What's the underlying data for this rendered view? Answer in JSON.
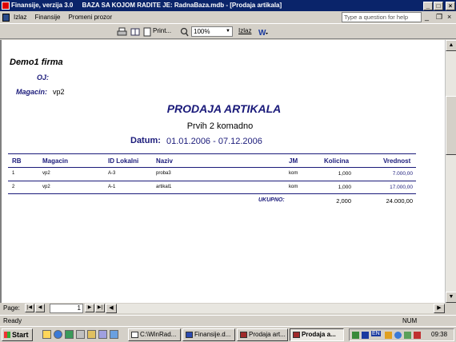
{
  "window": {
    "title": "Finansije, verzija 3.0     BAZA SA KOJOM RADITE JE: RadnaBaza.mdb - [Prodaja artikala]",
    "controls": {
      "minimize": "_",
      "maximize": "□",
      "close": "×"
    }
  },
  "menu": {
    "items": [
      "Izlaz",
      "Finansije",
      "Promeni prozor"
    ],
    "help_placeholder": "Type a question for help",
    "mdi_controls": {
      "minimize": "_",
      "restore": "❐",
      "close": "×"
    }
  },
  "toolbar": {
    "print_label": "Print...",
    "zoom_value": "100%",
    "exit_label": "Izlaz"
  },
  "report": {
    "company": "Demo1 firma",
    "oj_label": "OJ:",
    "oj_value": "",
    "magacin_label": "Magacin:",
    "magacin_value": "vp2",
    "title": "PRODAJA ARTIKALA",
    "subtitle": "Prvih 2 komadno",
    "datum_label": "Datum:",
    "datum_value": "01.01.2006 - 07.12.2006",
    "columns": [
      "RB",
      "Magacin",
      "ID Lokalni",
      "Naziv",
      "JM",
      "Kolicina",
      "Vrednost"
    ],
    "rows": [
      {
        "rb": "1",
        "magacin": "vp2",
        "id": "A-3",
        "naziv": "proba3",
        "jm": "kom",
        "kolicina": "1,000",
        "vrednost": "7.000,00"
      },
      {
        "rb": "2",
        "magacin": "vp2",
        "id": "A-1",
        "naziv": "artikal1",
        "jm": "kom",
        "kolicina": "1,000",
        "vrednost": "17.000,00"
      }
    ],
    "total_label": "UKUPNO:",
    "total_kolicina": "2,000",
    "total_vrednost": "24.000,00"
  },
  "nav": {
    "page_label": "Page:",
    "page_value": "1"
  },
  "status": {
    "text": "Ready",
    "num": "NUM"
  },
  "taskbar": {
    "start_label": "Start",
    "tasks": [
      "C:\\WinRad...",
      "Finansije.d...",
      "Prodaja art...",
      "Prodaja a..."
    ],
    "tray_lang": "EN",
    "clock": "09:38"
  }
}
